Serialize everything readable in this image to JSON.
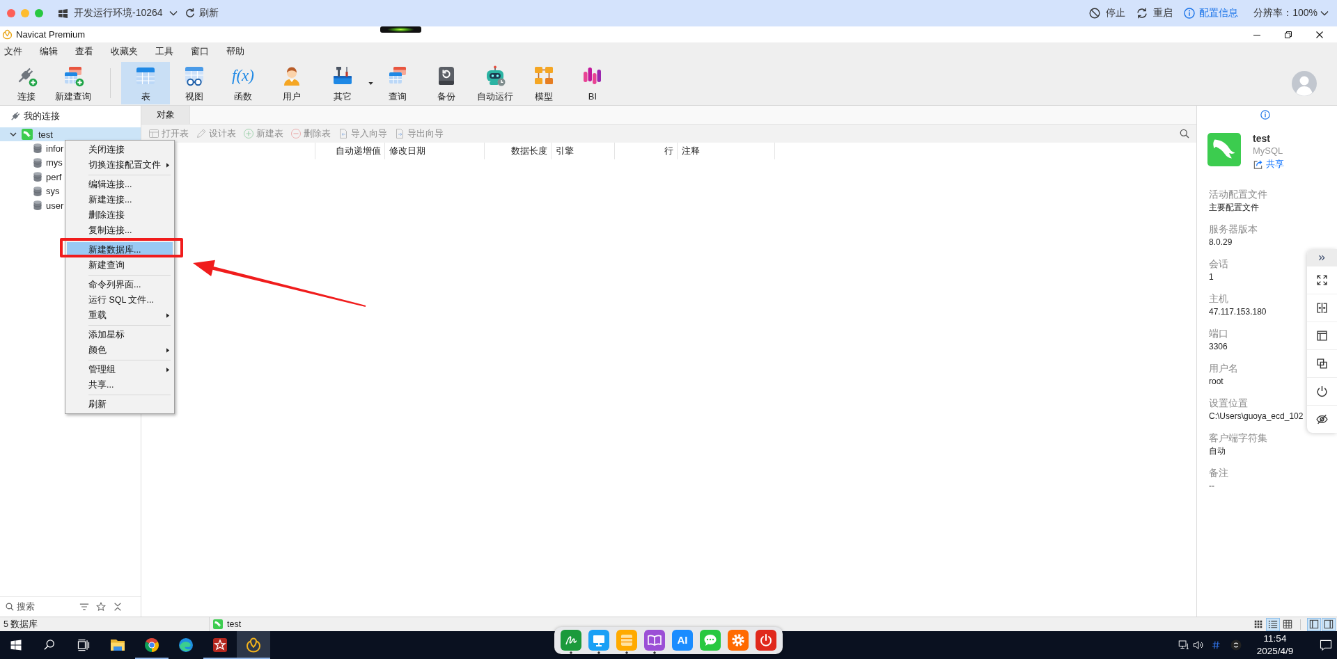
{
  "remote_bar": {
    "environment": "开发运行环境-10264",
    "refresh": "刷新",
    "actions": [
      {
        "kind": "stop",
        "label": "停止"
      },
      {
        "kind": "restart",
        "label": "重启"
      },
      {
        "kind": "info",
        "label": "配置信息"
      }
    ],
    "resolution": "分辨率：100%"
  },
  "window": {
    "title": "Navicat Premium"
  },
  "menu_bar": [
    "文件",
    "编辑",
    "查看",
    "收藏夹",
    "工具",
    "窗口",
    "帮助"
  ],
  "toolbar": {
    "groups": [
      [
        {
          "kind": "connection",
          "label": "连接",
          "selected": false,
          "dropdown": false
        },
        {
          "kind": "new_query",
          "label": "新建查询",
          "selected": false,
          "dropdown": false
        }
      ],
      [
        {
          "kind": "table",
          "label": "表",
          "selected": true,
          "dropdown": false
        },
        {
          "kind": "view",
          "label": "视图",
          "selected": false,
          "dropdown": false
        },
        {
          "kind": "function",
          "label": "函数",
          "glyph": "f(x)",
          "selected": false,
          "dropdown": false
        },
        {
          "kind": "user",
          "label": "用户",
          "selected": false,
          "dropdown": false
        },
        {
          "kind": "other",
          "label": "其它",
          "selected": false,
          "dropdown": true
        },
        {
          "kind": "query",
          "label": "查询",
          "selected": false,
          "dropdown": false
        },
        {
          "kind": "backup",
          "label": "备份",
          "selected": false,
          "dropdown": false
        },
        {
          "kind": "automation",
          "label": "自动运行",
          "selected": false,
          "dropdown": false
        },
        {
          "kind": "model",
          "label": "模型",
          "selected": false,
          "dropdown": false
        },
        {
          "kind": "bi",
          "label": "BI",
          "selected": false,
          "dropdown": false
        }
      ]
    ]
  },
  "tree": {
    "root": "我的连接",
    "connections": [
      {
        "name": "test",
        "selected": true,
        "expanded": true,
        "children": [
          {
            "name": "infor",
            "selected": false
          },
          {
            "name": "mys",
            "selected": false
          },
          {
            "name": "perf",
            "selected": false
          },
          {
            "name": "sys",
            "selected": false
          },
          {
            "name": "user",
            "selected": false
          }
        ]
      }
    ]
  },
  "sidebar_search": {
    "placeholder": "搜索"
  },
  "tabs": [
    {
      "label": "对象",
      "selected": true
    }
  ],
  "object_toolbar": [
    {
      "kind": "open",
      "label": "打开表",
      "disabled": true
    },
    {
      "kind": "design",
      "label": "设计表",
      "disabled": true
    },
    {
      "kind": "new",
      "label": "新建表",
      "disabled": true
    },
    {
      "kind": "delete",
      "label": "删除表",
      "disabled": true
    },
    {
      "kind": "import",
      "label": "导入向导",
      "disabled": true
    },
    {
      "kind": "export",
      "label": "导出向导",
      "disabled": true
    }
  ],
  "table": {
    "columns": [
      "自动递增值",
      "修改日期",
      "数据长度",
      "引擎",
      "行",
      "注释"
    ]
  },
  "info_panel": {
    "name": "test",
    "type": "MySQL",
    "share": "共享",
    "fields": [
      {
        "label": "活动配置文件",
        "value": "主要配置文件"
      },
      {
        "label": "服务器版本",
        "value": "8.0.29"
      },
      {
        "label": "会话",
        "value": "1"
      },
      {
        "label": "主机",
        "value": "47.117.153.180"
      },
      {
        "label": "端口",
        "value": "3306"
      },
      {
        "label": "用户名",
        "value": "root"
      },
      {
        "label": "设置位置",
        "value": "C:\\Users\\guoya_ecd_102"
      },
      {
        "label": "客户端字符集",
        "value": "自动"
      },
      {
        "label": "备注",
        "value": "--"
      }
    ]
  },
  "context_menu": {
    "groups": [
      [
        {
          "label": "关闭连接",
          "submenu": false,
          "selected": false
        },
        {
          "label": "切换连接配置文件",
          "submenu": true,
          "selected": false
        }
      ],
      [
        {
          "label": "编辑连接...",
          "submenu": false,
          "selected": false
        },
        {
          "label": "新建连接...",
          "submenu": false,
          "selected": false
        },
        {
          "label": "删除连接",
          "submenu": false,
          "selected": false
        },
        {
          "label": "复制连接...",
          "submenu": false,
          "selected": false
        }
      ],
      [
        {
          "label": "新建数据库...",
          "submenu": false,
          "selected": true
        },
        {
          "label": "新建查询",
          "submenu": false,
          "selected": false
        }
      ],
      [
        {
          "label": "命令列界面...",
          "submenu": false,
          "selected": false
        },
        {
          "label": "运行 SQL 文件...",
          "submenu": false,
          "selected": false
        },
        {
          "label": "重载",
          "submenu": true,
          "selected": false
        }
      ],
      [
        {
          "label": "添加星标",
          "submenu": false,
          "selected": false
        },
        {
          "label": "颜色",
          "submenu": true,
          "selected": false
        }
      ],
      [
        {
          "label": "管理组",
          "submenu": true,
          "selected": false
        },
        {
          "label": "共享...",
          "submenu": false,
          "selected": false
        }
      ],
      [
        {
          "label": "刷新",
          "submenu": false,
          "selected": false
        }
      ]
    ]
  },
  "status_bar": {
    "summary": "5 数据库",
    "connection": "test",
    "view_modes": [
      {
        "kind": "dots",
        "selected": false
      },
      {
        "kind": "lines",
        "selected": true
      },
      {
        "kind": "grid",
        "selected": false
      }
    ],
    "panels": [
      {
        "kind": "left",
        "on": true
      },
      {
        "kind": "right",
        "on": true
      }
    ]
  },
  "taskbar": {
    "apps": [
      {
        "kind": "explorer",
        "running": false,
        "active": false
      },
      {
        "kind": "chrome",
        "running": true,
        "active": false
      },
      {
        "kind": "edge",
        "running": false,
        "active": false
      },
      {
        "kind": "app",
        "running": true,
        "active": false
      },
      {
        "kind": "navicat",
        "running": true,
        "active": true
      }
    ],
    "clock": {
      "time": "11:54",
      "date": "2025/4/9"
    }
  },
  "dock": [
    {
      "kind": "sign",
      "running": true
    },
    {
      "kind": "monitor",
      "running": true
    },
    {
      "kind": "list",
      "running": true
    },
    {
      "kind": "book",
      "running": true
    },
    {
      "kind": "ai",
      "label": "AI",
      "running": false
    },
    {
      "kind": "chat",
      "running": false
    },
    {
      "kind": "settings",
      "running": false
    },
    {
      "kind": "power",
      "running": false
    }
  ]
}
